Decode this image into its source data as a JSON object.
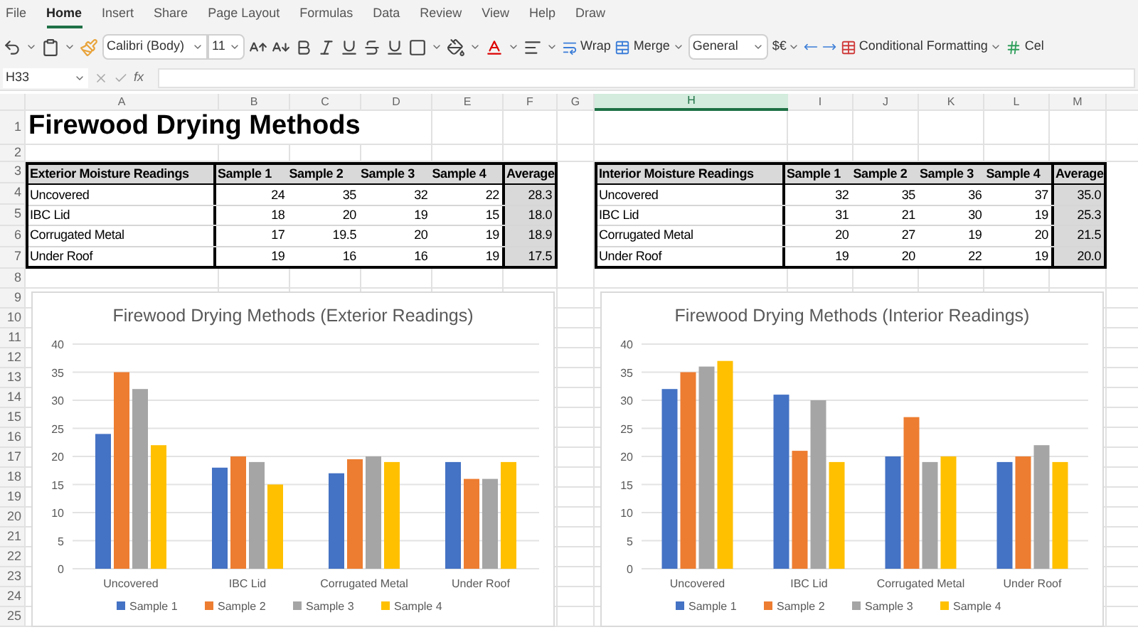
{
  "menu_tabs": [
    {
      "label": "File",
      "selected": false
    },
    {
      "label": "Home",
      "selected": true
    },
    {
      "label": "Insert",
      "selected": false
    },
    {
      "label": "Share",
      "selected": false
    },
    {
      "label": "Page Layout",
      "selected": false
    },
    {
      "label": "Formulas",
      "selected": false
    },
    {
      "label": "Data",
      "selected": false
    },
    {
      "label": "Review",
      "selected": false
    },
    {
      "label": "View",
      "selected": false
    },
    {
      "label": "Help",
      "selected": false
    },
    {
      "label": "Draw",
      "selected": false
    }
  ],
  "toolbar": {
    "font_name": "Calibri (Body)",
    "font_size": "11",
    "wrap": "Wrap",
    "merge": "Merge",
    "number_format": "General",
    "currency": "$€",
    "conditional_formatting": "Conditional Formatting",
    "cell_styles": "Cel"
  },
  "formula_bar": {
    "name_box": "H33",
    "function_label": "fx"
  },
  "column_headers": [
    {
      "label": "A",
      "selected": false
    },
    {
      "label": "B",
      "selected": false
    },
    {
      "label": "C",
      "selected": false
    },
    {
      "label": "D",
      "selected": false
    },
    {
      "label": "E",
      "selected": false
    },
    {
      "label": "F",
      "selected": false
    },
    {
      "label": "G",
      "selected": false
    },
    {
      "label": "H",
      "selected": true
    },
    {
      "label": "I",
      "selected": false
    },
    {
      "label": "J",
      "selected": false
    },
    {
      "label": "K",
      "selected": false
    },
    {
      "label": "L",
      "selected": false
    },
    {
      "label": "M",
      "selected": false
    }
  ],
  "row_numbers": [
    "1",
    "2",
    "3",
    "4",
    "5",
    "6",
    "7",
    "8",
    "9",
    "10",
    "11",
    "12",
    "13",
    "14",
    "15",
    "16",
    "17",
    "18",
    "19",
    "20",
    "21",
    "22",
    "23",
    "24",
    "25"
  ],
  "sheet_title": "Firewood Drying Methods",
  "tables": [
    {
      "headers": [
        "Exterior Moisture Readings",
        "Sample 1",
        "Sample 2",
        "Sample 3",
        "Sample 4",
        "Average"
      ],
      "rows": [
        {
          "label": "Uncovered",
          "values": [
            "24",
            "35",
            "32",
            "22"
          ],
          "average": "28.3"
        },
        {
          "label": "IBC Lid",
          "values": [
            "18",
            "20",
            "19",
            "15"
          ],
          "average": "18.0"
        },
        {
          "label": "Corrugated Metal",
          "values": [
            "17",
            "19.5",
            "20",
            "19"
          ],
          "average": "18.9"
        },
        {
          "label": "Under Roof",
          "values": [
            "19",
            "16",
            "16",
            "19"
          ],
          "average": "17.5"
        }
      ]
    },
    {
      "headers": [
        "Interior Moisture Readings",
        "Sample 1",
        "Sample 2",
        "Sample 3",
        "Sample 4",
        "Average"
      ],
      "rows": [
        {
          "label": "Uncovered",
          "values": [
            "32",
            "35",
            "36",
            "37"
          ],
          "average": "35.0"
        },
        {
          "label": "IBC Lid",
          "values": [
            "31",
            "21",
            "30",
            "19"
          ],
          "average": "25.3"
        },
        {
          "label": "Corrugated Metal",
          "values": [
            "20",
            "27",
            "19",
            "20"
          ],
          "average": "21.5"
        },
        {
          "label": "Under Roof",
          "values": [
            "19",
            "20",
            "22",
            "19"
          ],
          "average": "20.0"
        }
      ]
    }
  ],
  "charts": [
    {
      "chart_data": {
        "type": "bar",
        "title": "Firewood Drying Methods (Exterior Readings)",
        "categories": [
          "Uncovered",
          "IBC Lid",
          "Corrugated Metal",
          "Under Roof"
        ],
        "series": [
          {
            "name": "Sample 1",
            "color": "#4472c4",
            "values": [
              24,
              18,
              17,
              19
            ]
          },
          {
            "name": "Sample 2",
            "color": "#ed7d31",
            "values": [
              35,
              20,
              19.5,
              16
            ]
          },
          {
            "name": "Sample 3",
            "color": "#a5a5a5",
            "values": [
              32,
              19,
              20,
              16
            ]
          },
          {
            "name": "Sample 4",
            "color": "#ffc000",
            "values": [
              22,
              15,
              19,
              19
            ]
          }
        ],
        "ylim": [
          0,
          40
        ],
        "yticks": [
          0,
          5,
          10,
          15,
          20,
          25,
          30,
          35,
          40
        ],
        "grid": true,
        "legend": "bottom"
      }
    },
    {
      "chart_data": {
        "type": "bar",
        "title": "Firewood Drying Methods (Interior Readings)",
        "categories": [
          "Uncovered",
          "IBC Lid",
          "Corrugated Metal",
          "Under Roof"
        ],
        "series": [
          {
            "name": "Sample 1",
            "color": "#4472c4",
            "values": [
              32,
              31,
              20,
              19
            ]
          },
          {
            "name": "Sample 2",
            "color": "#ed7d31",
            "values": [
              35,
              21,
              27,
              20
            ]
          },
          {
            "name": "Sample 3",
            "color": "#a5a5a5",
            "values": [
              36,
              30,
              19,
              22
            ]
          },
          {
            "name": "Sample 4",
            "color": "#ffc000",
            "values": [
              37,
              19,
              20,
              19
            ]
          }
        ],
        "ylim": [
          0,
          40
        ],
        "yticks": [
          0,
          5,
          10,
          15,
          20,
          25,
          30,
          35,
          40
        ],
        "grid": true,
        "legend": "bottom"
      }
    }
  ]
}
